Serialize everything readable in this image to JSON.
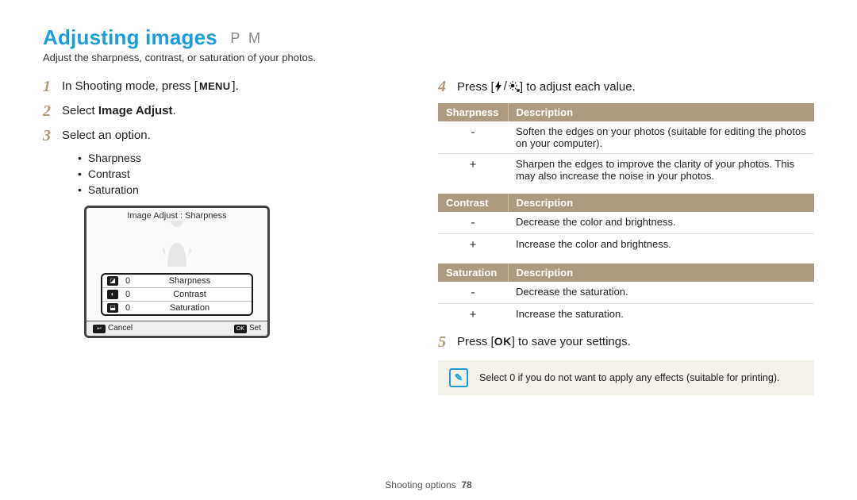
{
  "header": {
    "title": "Adjusting images",
    "modes": "P M",
    "subtitle": "Adjust the sharpness, contrast, or saturation of your photos."
  },
  "steps": {
    "s1_a": "In Shooting mode, press [",
    "s1_b": "].",
    "menu_label": "MENU",
    "s2_a": "Select ",
    "s2_b": "Image Adjust",
    "s2_c": ".",
    "s3": "Select an option.",
    "bullets": [
      "Sharpness",
      "Contrast",
      "Saturation"
    ],
    "s4_a": "Press [",
    "s4_b": "] to adjust each value.",
    "s5_a": "Press [",
    "s5_b": "] to save your settings.",
    "ok_label": "OK"
  },
  "cam": {
    "top": "Image Adjust : Sharpness",
    "rows": [
      {
        "val": "0",
        "name": "Sharpness"
      },
      {
        "val": "0",
        "name": "Contrast"
      },
      {
        "val": "0",
        "name": "Saturation"
      }
    ],
    "foot_left": "Cancel",
    "foot_right": "Set",
    "foot_right_key": "OK"
  },
  "tables": [
    {
      "head_a": "Sharpness",
      "head_b": "Description",
      "rows": [
        {
          "sym": "-",
          "desc": "Soften the edges on your photos (suitable for editing the photos on your computer)."
        },
        {
          "sym": "+",
          "desc": "Sharpen the edges to improve the clarity of your photos. This may also increase the noise in your photos."
        }
      ]
    },
    {
      "head_a": "Contrast",
      "head_b": "Description",
      "rows": [
        {
          "sym": "-",
          "desc": "Decrease the color and brightness."
        },
        {
          "sym": "+",
          "desc": "Increase the color and brightness."
        }
      ]
    },
    {
      "head_a": "Saturation",
      "head_b": "Description",
      "rows": [
        {
          "sym": "-",
          "desc": "Decrease the saturation."
        },
        {
          "sym": "+",
          "desc": "Increase the saturation."
        }
      ]
    }
  ],
  "note": {
    "text": "Select 0 if you do not want to apply any effects (suitable for printing)."
  },
  "footer": {
    "section": "Shooting options",
    "page": "78"
  }
}
